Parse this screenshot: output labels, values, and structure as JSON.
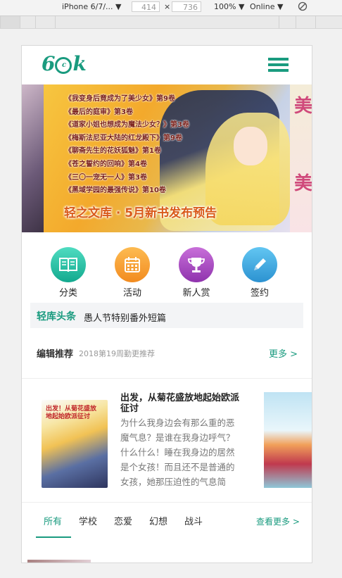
{
  "devtools": {
    "device": "iPhone 6/7/...",
    "width": "414",
    "height": "736",
    "zoom": "100%",
    "network": "Online",
    "separator": "×"
  },
  "header": {
    "logo_text_left": "6",
    "logo_text_mid": "c",
    "logo_text_right": "k"
  },
  "banner": {
    "list": [
      "《我变身后竟成为了美少女》第9卷",
      "《最后的庭审》第3卷",
      "《道家小姐也想成为魔法少女？》第3卷",
      "《梅斯法尼亚大陆的红龙殿下》第9卷",
      "《聊斋先生的花妖狐魅》第1卷",
      "《苍之誓约的回响》第4卷",
      "《三〇一宠无一人》第3卷",
      "《黑域学园的最强传说》第10卷"
    ],
    "title": "轻之文库 · 5月新书发布预告",
    "right_text": "美"
  },
  "quick_nav": [
    {
      "label": "分类",
      "icon": "book-icon",
      "color_top": "#4fdcc1",
      "color_bottom": "#13a98f"
    },
    {
      "label": "活动",
      "icon": "calendar-icon",
      "color_top": "#fdbb52",
      "color_bottom": "#f28b1f"
    },
    {
      "label": "新人赏",
      "icon": "trophy-icon",
      "color_top": "#c86fd9",
      "color_bottom": "#8f33ad"
    },
    {
      "label": "签约",
      "icon": "pencil-icon",
      "color_top": "#62c6f2",
      "color_bottom": "#2c92d1"
    }
  ],
  "headline": {
    "label": "轻库头条",
    "text": "愚人节特别番外短篇"
  },
  "recommend": {
    "title": "编辑推荐",
    "subtitle": "2018第19周勤更推荐",
    "more": "更多 >",
    "book": {
      "title": "出发，从菊花盛放地起始欧派征讨",
      "description": "为什么我身边会有那么重的恶魔气息？是谁在我身边呼气？什么什么！睡在我身边的居然是个女孩！而且还不是普通的女孩，她那压迫性的气息简",
      "cover_text": "出发！从菊花盛放地起始欧派征讨"
    }
  },
  "tabs": {
    "items": [
      "所有",
      "学校",
      "恋爱",
      "幻想",
      "战斗"
    ],
    "active": 0,
    "more": "查看更多 >"
  }
}
